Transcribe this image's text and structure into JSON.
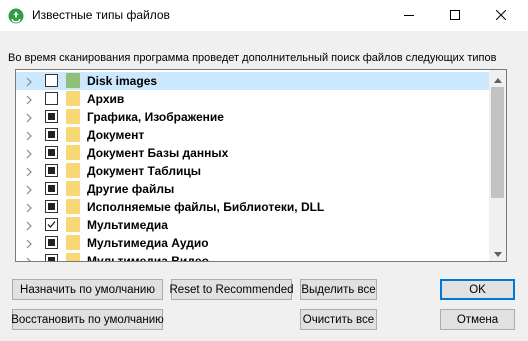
{
  "window": {
    "title": "Известные типы файлов",
    "icon": "recycle-icon",
    "controls": [
      "minimize-icon",
      "maximize-icon",
      "close-icon"
    ]
  },
  "description": "Во время сканирования программа проведет дополнительный поиск файлов следующих типов",
  "file_types": [
    {
      "label": "Disk images",
      "state": "unchecked",
      "icon": "folder-icon",
      "icon_color": "#8fc07a",
      "selected": true
    },
    {
      "label": "Архив",
      "state": "unchecked",
      "icon": "folder-icon",
      "icon_color": "#f8d775",
      "selected": false
    },
    {
      "label": "Графика, Изображение",
      "state": "partial",
      "icon": "folder-icon",
      "icon_color": "#f8d775",
      "selected": false
    },
    {
      "label": "Документ",
      "state": "partial",
      "icon": "folder-icon",
      "icon_color": "#f8d775",
      "selected": false
    },
    {
      "label": "Документ Базы данных",
      "state": "partial",
      "icon": "folder-icon",
      "icon_color": "#f8d775",
      "selected": false
    },
    {
      "label": "Документ Таблицы",
      "state": "partial",
      "icon": "folder-icon",
      "icon_color": "#f8d775",
      "selected": false
    },
    {
      "label": "Другие файлы",
      "state": "partial",
      "icon": "folder-icon",
      "icon_color": "#f8d775",
      "selected": false
    },
    {
      "label": "Исполняемые файлы, Библиотеки, DLL",
      "state": "partial",
      "icon": "folder-icon",
      "icon_color": "#f8d775",
      "selected": false
    },
    {
      "label": "Мультимедиа",
      "state": "checked",
      "icon": "folder-icon",
      "icon_color": "#f8d775",
      "selected": false
    },
    {
      "label": "Мультимедиа Аудио",
      "state": "partial",
      "icon": "folder-icon",
      "icon_color": "#f8d775",
      "selected": false
    },
    {
      "label": "Мультимедиа Видео",
      "state": "partial",
      "icon": "folder-icon",
      "icon_color": "#f8d775",
      "selected": false
    }
  ],
  "buttons": {
    "set_default": "Назначить по умолчанию",
    "reset_recommended": "Reset to Recommended",
    "select_all": "Выделить все",
    "ok": "OK",
    "restore_default": "Восстановить по умолчанию",
    "clear_all": "Очистить все",
    "cancel": "Отмена"
  },
  "colors": {
    "selection": "#cce8ff",
    "default_button_border": "#0078d7"
  }
}
